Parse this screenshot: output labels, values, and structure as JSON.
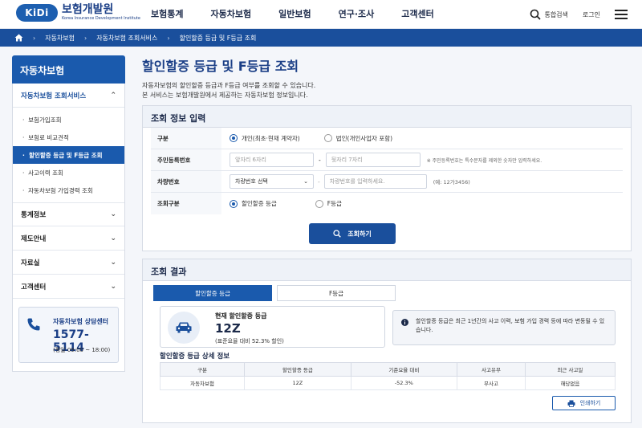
{
  "header": {
    "logo_badge": "KiDi",
    "logo_name": "보험개발원",
    "logo_sub": "Korea Insurance Development Institute",
    "nav": [
      "보험통계",
      "자동차보험",
      "일반보험",
      "연구·조사",
      "고객센터"
    ],
    "search_label": "통합검색",
    "login_label": "로그인"
  },
  "breadcrumb": [
    "자동차보험",
    "자동차보험 조회서비스",
    "할인할증 등급 및 F등급 조회"
  ],
  "sidebar": {
    "title": "자동차보험",
    "section_open": "자동차보험 조회서비스",
    "sub_items": [
      "보험가입조회",
      "보험료 비교견적",
      "할인할증 등급 및 F등급 조회",
      "사고이력 조회",
      "자동차보험 가입경력 조회"
    ],
    "sections": [
      "통계정보",
      "제도안내",
      "자료실",
      "고객센터"
    ],
    "contact": {
      "title": "자동차보험 상담센터",
      "phone": "1577-5114",
      "hours": "(평일 09:00 ~ 18:00)"
    }
  },
  "main": {
    "title": "할인할증 등급 및 F등급 조회",
    "desc1": "자동차보험의 할인할증 등급과 F등급 여부를 조회할 수 있습니다.",
    "desc2": "본 서비스는 보험개발원에서 제공하는 자동차보험 정보입니다."
  },
  "form": {
    "title": "조회 정보 입력",
    "labels": [
      "구분",
      "주민등록번호",
      "차량번호",
      "조회구분"
    ],
    "type_options": [
      "개인(최초·현재 계약자)",
      "법인(개인사업자 포함)"
    ],
    "rrn_front_placeholder": "앞자리 6자리",
    "rrn_back_placeholder": "뒷자리 7자리",
    "rrn_hint": "※ 주민등록번호는 특수문자를 제외한 숫자만 입력하세요.",
    "dash": "-",
    "car_select": "차량번호 선택",
    "car_placeholder": "차량번호를 입력하세요.",
    "car_example": "(예: 12가3456)",
    "query_options": [
      "할인할증 등급",
      "F등급"
    ],
    "submit_label": "조회하기"
  },
  "result": {
    "title": "조회 결과",
    "tabs": [
      "할인할증 등급",
      "F등급"
    ],
    "grade_label": "현재 할인할증 등급",
    "grade_value": "12Z",
    "grade_note": "(표준요율 대비 52.3% 할인)",
    "info_text": "할인할증 등급은 최근 1년간의 사고 이력, 보험 가입 경력 등에 따라 변동될 수 있습니다.",
    "detail_title": "할인할증 등급 상세 정보",
    "table": {
      "headers": [
        "구분",
        "할인할증 등급",
        "기준요율 대비",
        "사고유무",
        "최근 사고일"
      ],
      "row": [
        "자동차보험",
        "12Z",
        "-52.3%",
        "무사고",
        "해당없음"
      ]
    },
    "print_label": "인쇄하기"
  },
  "colors": {
    "primary": "#1a5aad",
    "dark_blue": "#1a4f9c",
    "navy": "#1a3e86"
  }
}
